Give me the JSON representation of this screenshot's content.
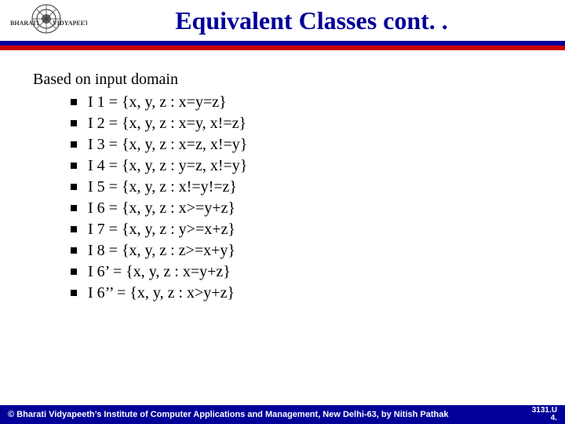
{
  "header": {
    "title": "Equivalent Classes cont. ."
  },
  "content": {
    "intro": "Based on input domain",
    "items": [
      "I 1 =  {x, y, z : x=y=z}",
      "I 2 =  {x, y, z : x=y, x!=z}",
      "I 3 =  {x, y, z : x=z, x!=y}",
      "I 4 =  {x, y, z : y=z, x!=y}",
      "I 5 =  {x, y, z : x!=y!=z}",
      "I 6 =  {x, y, z : x>=y+z}",
      "I 7 =  {x, y, z : y>=x+z}",
      "I 8 =  {x, y, z : z>=x+y}",
      "I 6’ = {x, y, z : x=y+z}",
      "I 6’’ = {x, y, z : x>y+z}"
    ]
  },
  "footer": {
    "copyright": "© Bharati Vidyapeeth’s Institute of Computer Applications and Management, New Delhi-63, by  Nitish Pathak",
    "pageinfo": "3131.U\n4."
  }
}
